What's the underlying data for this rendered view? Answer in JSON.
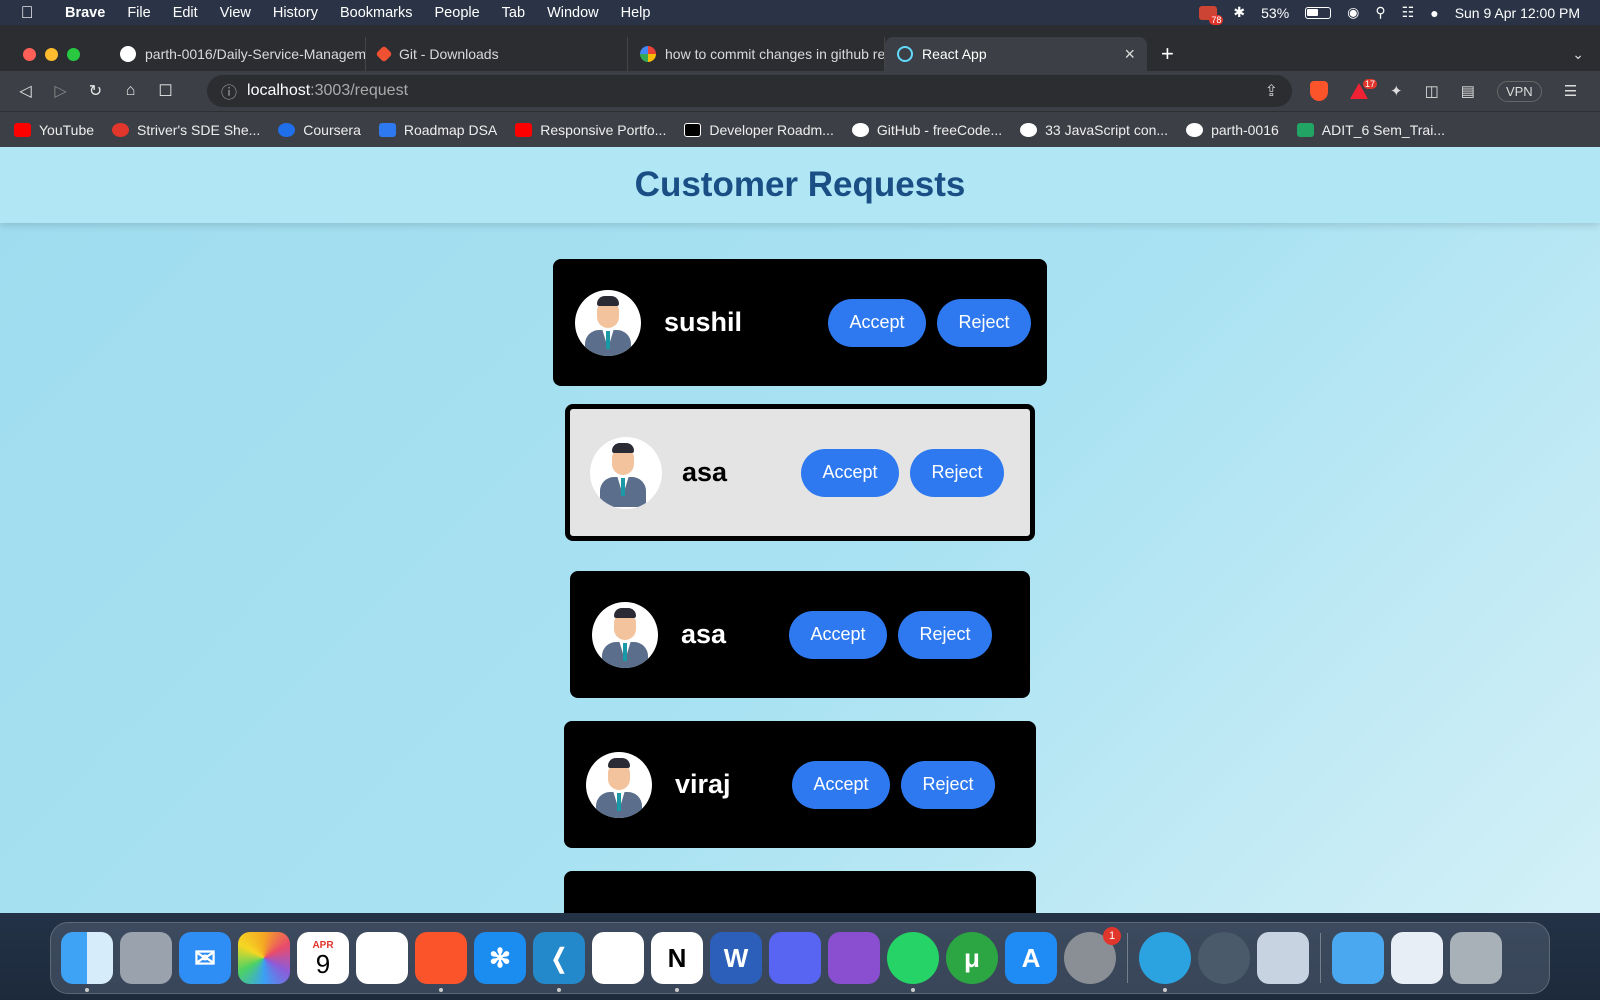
{
  "menubar": {
    "app": "Brave",
    "items": [
      "File",
      "Edit",
      "View",
      "History",
      "Bookmarks",
      "People",
      "Tab",
      "Window",
      "Help"
    ],
    "badge": "78",
    "battery": "53%",
    "datetime": "Sun 9 Apr  12:00 PM"
  },
  "tabs": [
    {
      "title": "parth-0016/Daily-Service-Managem",
      "icon": "github-icon"
    },
    {
      "title": "Git - Downloads",
      "icon": "git-icon"
    },
    {
      "title": "how to commit changes in github re",
      "icon": "google-icon"
    },
    {
      "title": "React App",
      "icon": "react-icon",
      "active": true
    }
  ],
  "toolbar": {
    "url_host": "localhost",
    "url_path": ":3003/request",
    "rewards_badge": "17",
    "vpn": "VPN"
  },
  "bookmarks": [
    {
      "label": "YouTube",
      "color": "#ff0000"
    },
    {
      "label": "Striver's SDE She...",
      "color": "#e0362c"
    },
    {
      "label": "Coursera",
      "color": "#1f6feb"
    },
    {
      "label": "Roadmap DSA",
      "color": "#2e79f0"
    },
    {
      "label": "Responsive Portfo...",
      "color": "#ff0000"
    },
    {
      "label": "Developer Roadm...",
      "color": "#000000"
    },
    {
      "label": "GitHub - freeCode...",
      "color": "#ffffff"
    },
    {
      "label": "33 JavaScript con...",
      "color": "#ffffff"
    },
    {
      "label": "parth-0016",
      "color": "#ffffff"
    },
    {
      "label": "ADIT_6 Sem_Trai...",
      "color": "#21a464"
    }
  ],
  "page": {
    "title": "Customer Requests",
    "requests": [
      {
        "name": "sushil",
        "accept": "Accept",
        "reject": "Reject"
      },
      {
        "name": "asa",
        "accept": "Accept",
        "reject": "Reject",
        "highlighted": true
      },
      {
        "name": "asa",
        "accept": "Accept",
        "reject": "Reject"
      },
      {
        "name": "viraj",
        "accept": "Accept",
        "reject": "Reject"
      }
    ]
  },
  "dock": {
    "apps": [
      "finder-icon",
      "launchpad-icon",
      "mail-icon",
      "photos-icon",
      "calendar-icon",
      "reminders-icon",
      "brave-icon",
      "safari-icon",
      "vscode-icon",
      "mongodb-icon",
      "notion-icon",
      "word-icon",
      "discord-icon",
      "github-desktop-icon",
      "whatsapp-icon",
      "utorrent-icon",
      "app-store-icon",
      "system-settings-icon",
      "telegram-icon",
      "quicktime-icon",
      "preview-icon",
      "downloads-folder-icon",
      "documents-stack-icon",
      "trash-icon"
    ],
    "calendar_month": "APR",
    "calendar_day": "9",
    "settings_badge": "1"
  }
}
